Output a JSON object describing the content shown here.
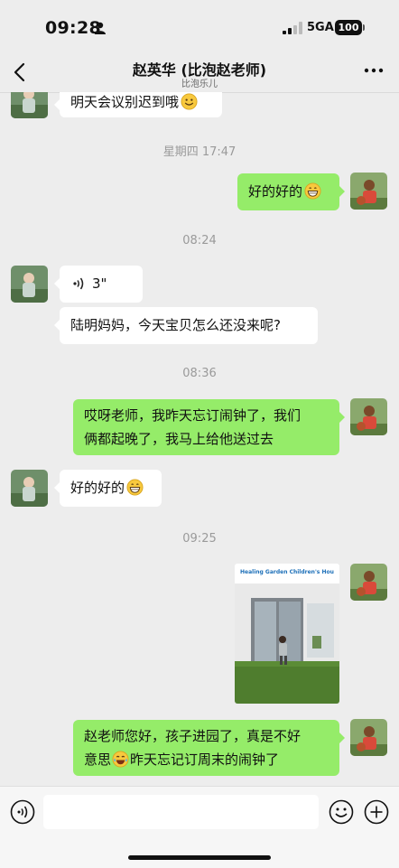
{
  "status_bar": {
    "time": "09:28",
    "network": "5GA",
    "battery": "100"
  },
  "header": {
    "title": "赵英华 (比泡赵老师)",
    "subtitle": "比泡乐儿"
  },
  "messages": [
    {
      "side": "in",
      "text": "明天会议别迟到哦",
      "emoji": "smile-emoji"
    },
    {
      "type": "timestamp",
      "text": "星期四 17:47"
    },
    {
      "side": "out",
      "text": "好的好的",
      "emoji": "grin-emoji"
    },
    {
      "type": "timestamp",
      "text": "08:24"
    },
    {
      "side": "in",
      "type": "voice",
      "duration": "3\""
    },
    {
      "side": "in",
      "text": "陆明妈妈，今天宝贝怎么还没来呢?"
    },
    {
      "type": "timestamp",
      "text": "08:36"
    },
    {
      "side": "out",
      "line1": "哎呀老师，我昨天忘订闹钟了，我们",
      "line2": "俩都起晚了，我马上给他送过去"
    },
    {
      "side": "in",
      "text": "好的好的",
      "emoji": "grin-emoji"
    },
    {
      "type": "timestamp",
      "text": "09:25"
    },
    {
      "side": "out",
      "type": "image",
      "sign": "Healing Garden Children's House"
    },
    {
      "side": "out",
      "line1": "赵老师您好，孩子进园了，真是不好",
      "line2_prefix": "意思",
      "emoji": "laugh-cry-emoji",
      "line2_suffix": "昨天忘记订周末的闹钟了"
    }
  ],
  "input": {
    "placeholder": ""
  },
  "colors": {
    "background": "#ededed",
    "outgoing_bubble": "#95ec69",
    "incoming_bubble": "#ffffff",
    "timestamp": "#9a9a9a"
  }
}
